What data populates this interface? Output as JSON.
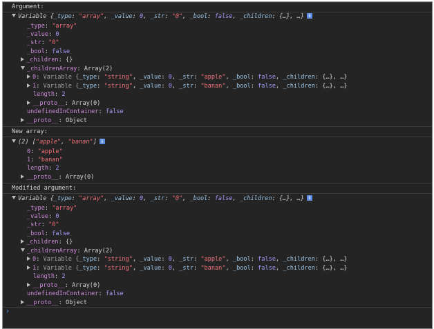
{
  "labels": {
    "argument": "Argument:",
    "new_array": "New array:",
    "modified_argument": "Modified argument:"
  },
  "obj": {
    "summary_prefix": "Variable {",
    "type_key": "_type",
    "value_key": "_value",
    "str_key": "_str",
    "bool_key": "_bool",
    "children_key": "_children",
    "children_array_key": "_childrenArray",
    "undefined_key": "undefinedInContainer",
    "proto_key": "__proto__",
    "type_val": "\"array\"",
    "value_val": "0",
    "str_val": "\"0\"",
    "bool_val": "false",
    "children_val": "{}",
    "children_short": "{…}",
    "ellipsis": "…}",
    "children_array_val": "Array(2)",
    "undefined_val": "false",
    "proto_val": "Object",
    "length_key": "length",
    "length_val": "2",
    "array_proto_val": "Array(0)",
    "child_type": "\"string\"",
    "child_prefix": "Variable {",
    "child_end": "…}",
    "children": [
      {
        "index": "0",
        "str": "\"apple\""
      },
      {
        "index": "1",
        "str": "\"banan\""
      }
    ]
  },
  "new_array": {
    "summary_count": "(2)",
    "summary_items": [
      "\"apple\"",
      "\"banan\""
    ],
    "items": [
      {
        "index": "0",
        "value": "\"apple\""
      },
      {
        "index": "1",
        "value": "\"banan\""
      }
    ],
    "length_val": "2",
    "proto_val": "Array(0)"
  },
  "prompt_symbol": "›",
  "info_badge": "i"
}
